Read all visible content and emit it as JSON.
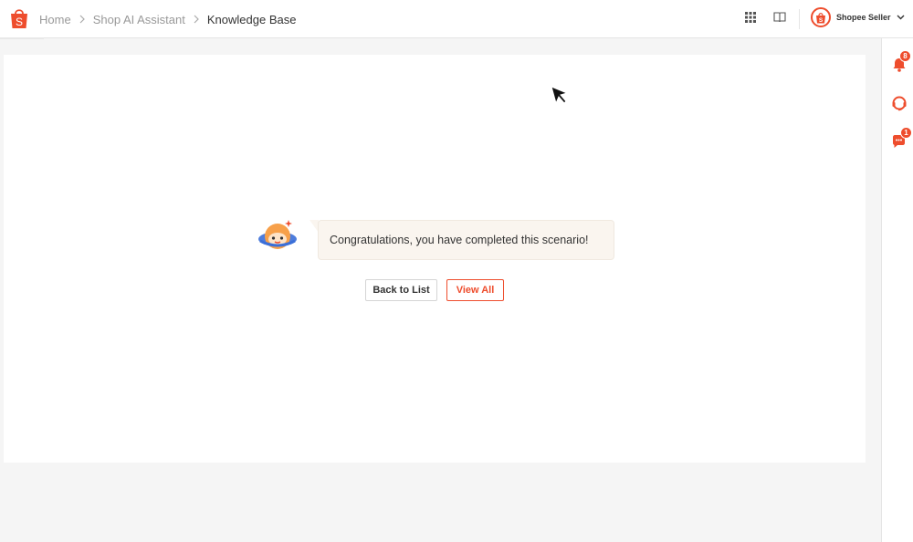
{
  "breadcrumb": {
    "items": [
      "Home",
      "Shop AI Assistant",
      "Knowledge Base"
    ]
  },
  "account": {
    "name": "Shopee Seller"
  },
  "sidebar": {
    "notification_count": "8",
    "chat_count": "1"
  },
  "main": {
    "message": "Congratulations, you have completed this scenario!",
    "back_label": "Back to List",
    "view_all_label": "View All"
  },
  "colors": {
    "brand": "#ee4d2d",
    "bubble_bg": "#faf5ef"
  },
  "icons": [
    "shopee-logo-icon",
    "chevron-right-icon",
    "apps-grid-icon",
    "book-icon",
    "shop-avatar-icon",
    "chevron-down-icon",
    "bell-icon",
    "headset-icon",
    "chat-icon",
    "mascot-icon",
    "cursor-icon"
  ]
}
